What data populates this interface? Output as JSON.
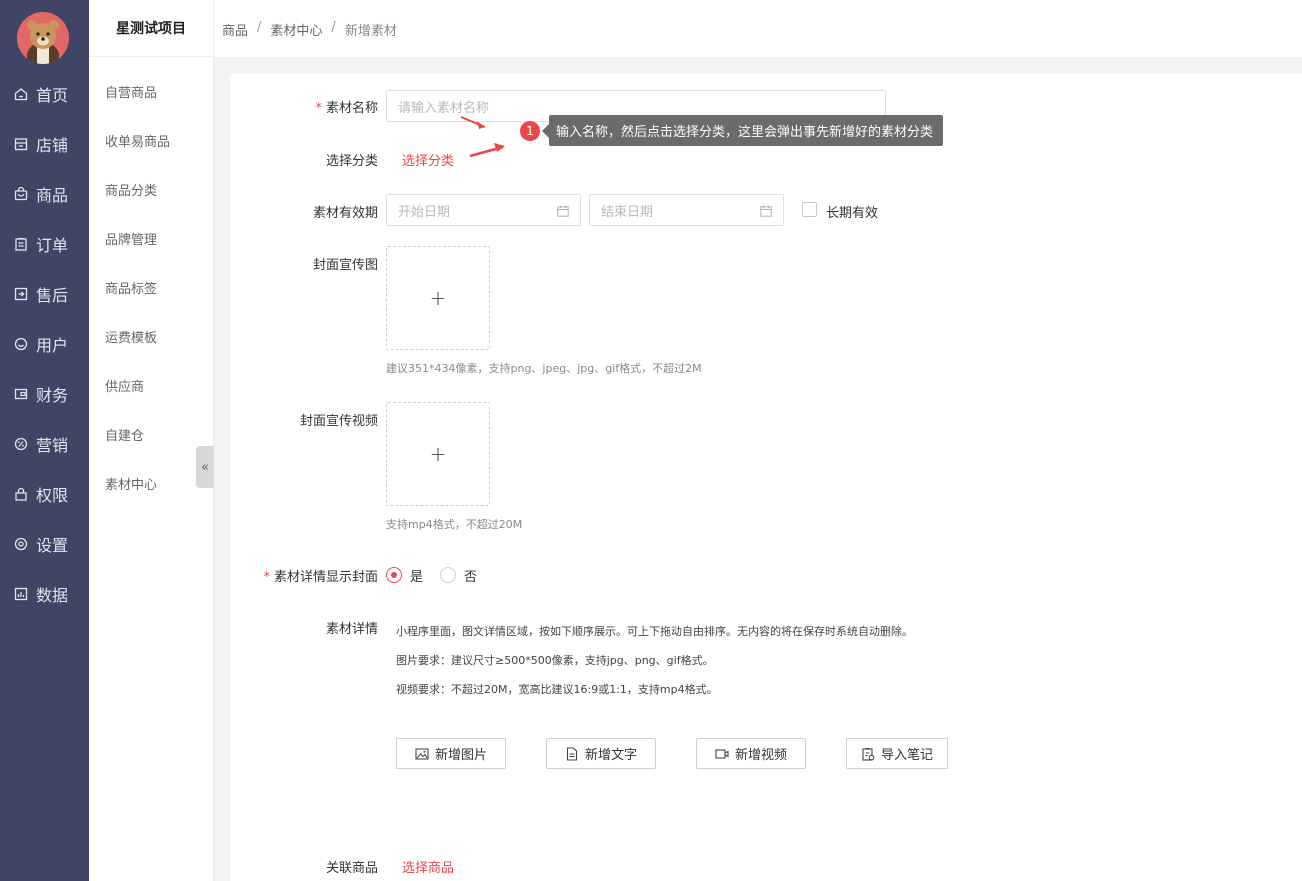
{
  "nav": {
    "items": [
      {
        "label": "首页",
        "icon": "home-icon"
      },
      {
        "label": "店铺",
        "icon": "store-icon"
      },
      {
        "label": "商品",
        "icon": "bag-icon"
      },
      {
        "label": "订单",
        "icon": "clipboard-icon"
      },
      {
        "label": "售后",
        "icon": "after-sale-icon"
      },
      {
        "label": "用户",
        "icon": "user-icon"
      },
      {
        "label": "财务",
        "icon": "wallet-icon"
      },
      {
        "label": "营销",
        "icon": "percent-icon"
      },
      {
        "label": "权限",
        "icon": "lock-icon"
      },
      {
        "label": "设置",
        "icon": "gear-icon"
      },
      {
        "label": "数据",
        "icon": "chart-icon"
      }
    ]
  },
  "sidebar": {
    "title": "星测试项目",
    "items": [
      "自营商品",
      "收单易商品",
      "商品分类",
      "品牌管理",
      "商品标签",
      "运费模板",
      "供应商",
      "自建仓",
      "素材中心"
    ],
    "collapse_glyph": "«"
  },
  "breadcrumb": [
    "商品",
    "素材中心",
    "新增素材"
  ],
  "breadcrumb_sep": "/",
  "form": {
    "name_label": "素材名称",
    "required_mark": "*",
    "name_placeholder": "请输入素材名称",
    "category_label": "选择分类",
    "category_link": "选择分类",
    "validity_label": "素材有效期",
    "start_placeholder": "开始日期",
    "end_placeholder": "结束日期",
    "long_term_label": "长期有效",
    "cover_image_label": "封面宣传图",
    "cover_image_hint": "建议351*434像素，支持png、jpeg、jpg、gif格式，不超过2M",
    "cover_video_label": "封面宣传视频",
    "cover_video_hint": "支持mp4格式，不超过20M",
    "upload_plus": "+",
    "show_cover_label": "素材详情显示封面",
    "yes_label": "是",
    "no_label": "否",
    "detail_label": "素材详情",
    "detail_desc_1": "小程序里面，图文详情区域，按如下顺序展示。可上下拖动自由排序。无内容的将在保存时系统自动删除。",
    "detail_desc_2": "图片要求：建议尺寸≥500*500像素，支持jpg、png、gif格式。",
    "detail_desc_3": "视频要求：不超过20M，宽高比建议16:9或1:1，支持mp4格式。",
    "add_image_button": "新增图片",
    "add_text_button": "新增文字",
    "add_video_button": "新增视频",
    "import_note_button": "导入笔记",
    "related_goods_label": "关联商品",
    "related_goods_link": "选择商品"
  },
  "annotation": {
    "step": "1",
    "text": "输入名称，然后点击选择分类，这里会弹出事先新增好的素材分类"
  },
  "colors": {
    "nav_bg": "#414565",
    "accent": "#e8484a",
    "tooltip_bg": "#6b6b6b"
  }
}
